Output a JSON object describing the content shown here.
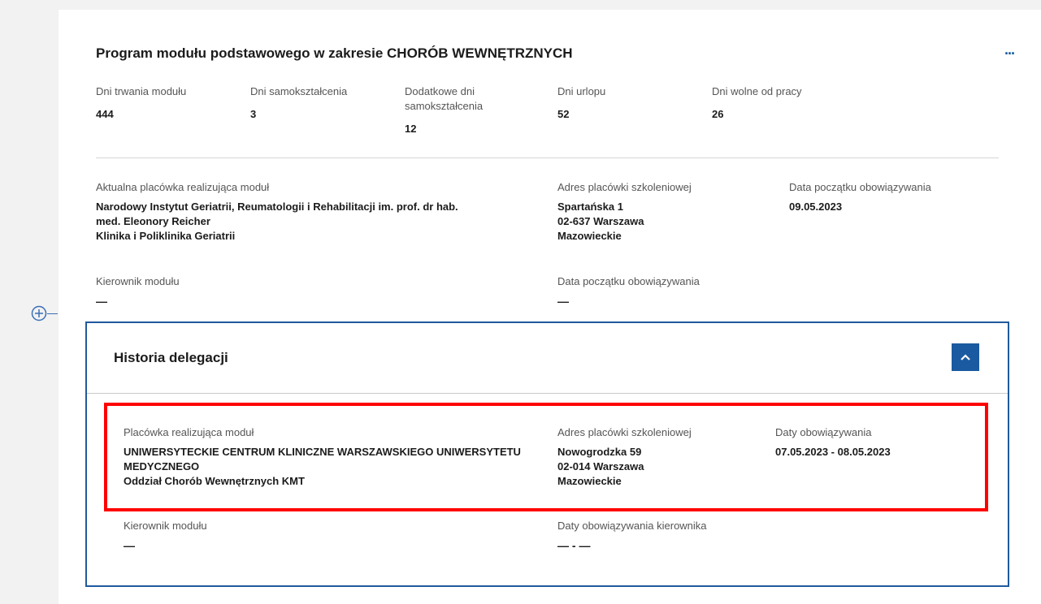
{
  "module": {
    "title": "Program modułu podstawowego w zakresie CHORÓB WEWNĘTRZNYCH",
    "more_label": "...",
    "stats": [
      {
        "label": "Dni trwania modułu",
        "value": "444"
      },
      {
        "label": "Dni samokształcenia",
        "value": "3"
      },
      {
        "label_line1": "Dodatkowe dni",
        "label_line2": "samokształcenia",
        "value": "12"
      },
      {
        "label": "Dni urlopu",
        "value": "52"
      },
      {
        "label": "Dni wolne od pracy",
        "value": "26"
      }
    ],
    "facility": {
      "label": "Aktualna placówka realizująca moduł",
      "name_line1": "Narodowy Instytut Geriatrii, Reumatologii i Rehabilitacji im. prof. dr hab.",
      "name_line2": "med. Eleonory Reicher",
      "name_line3": "Klinika i Poliklinika Geriatrii",
      "address_label": "Adres placówki szkoleniowej",
      "address_line1": "Spartańska 1",
      "address_line2": "02-637 Warszawa",
      "address_line3": "Mazowieckie",
      "start_label": "Data początku obowiązywania",
      "start_value": "09.05.2023"
    },
    "manager": {
      "label": "Kierownik modułu",
      "value": "—",
      "start_label": "Data początku obowiązywania",
      "start_value": "—"
    }
  },
  "history": {
    "title": "Historia delegacji",
    "entry": {
      "facility_label": "Placówka realizująca moduł",
      "name_line1": "UNIWERSYTECKIE CENTRUM KLINICZNE WARSZAWSKIEGO UNIWERSYTETU",
      "name_line2": "MEDYCZNEGO",
      "name_line3": "Oddział Chorób Wewnętrznych KMT",
      "address_label": "Adres placówki szkoleniowej",
      "address_line1": "Nowogrodzka 59",
      "address_line2": "02-014 Warszawa",
      "address_line3": "Mazowieckie",
      "dates_label": "Daty obowiązywania",
      "dates_value": "07.05.2023 - 08.05.2023"
    },
    "manager": {
      "label": "Kierownik modułu",
      "value": "—",
      "dates_label": "Daty obowiązywania kierownika",
      "dates_value": "— - —"
    }
  },
  "colors": {
    "accent": "#1a5aa0",
    "highlight": "#ff0000",
    "background": "#f2f2f2"
  }
}
